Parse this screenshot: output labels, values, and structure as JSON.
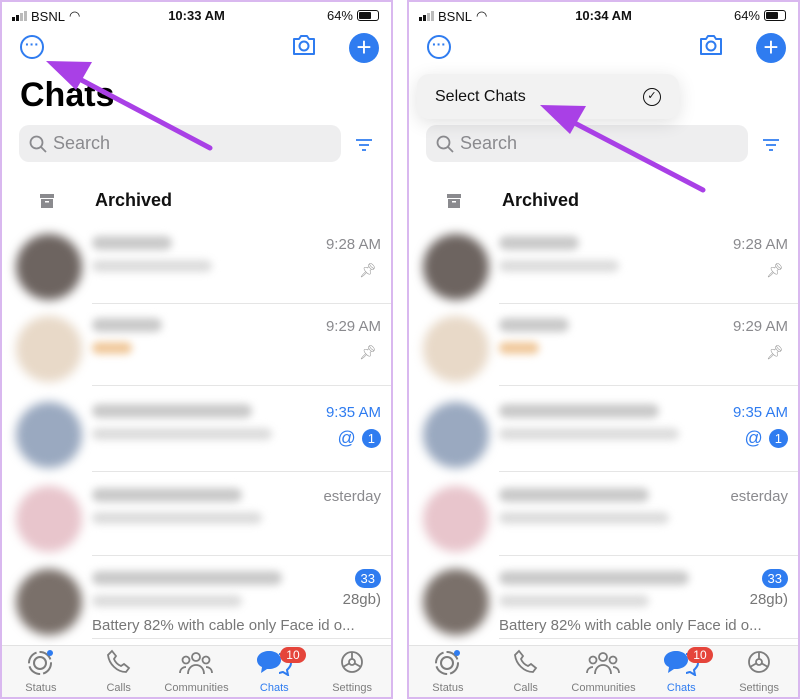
{
  "panels": [
    {
      "status": {
        "carrier": "BSNL",
        "time": "10:33 AM",
        "battery": "64%"
      },
      "menu": null
    },
    {
      "status": {
        "carrier": "BSNL",
        "time": "10:34 AM",
        "battery": "64%"
      },
      "menu": {
        "label": "Select Chats",
        "icon": "checkmark-circle-icon"
      }
    }
  ],
  "header": {
    "title": "Chats",
    "search_placeholder": "Search",
    "archived_label": "Archived"
  },
  "chats": [
    {
      "time": "9:28 AM",
      "pinned": true
    },
    {
      "time": "9:29 AM",
      "pinned": true
    },
    {
      "time": "9:35 AM",
      "unread_time": true,
      "mention": "@",
      "unread": "1"
    },
    {
      "time": "esterday"
    },
    {
      "unread": "33",
      "preview_end": "28gb)",
      "preview": "Battery 82% with cable only Face id o..."
    }
  ],
  "tabs": [
    {
      "label": "Status",
      "icon": "status-icon"
    },
    {
      "label": "Calls",
      "icon": "phone-icon"
    },
    {
      "label": "Communities",
      "icon": "communities-icon"
    },
    {
      "label": "Chats",
      "icon": "chat-bubbles-icon",
      "badge": "10",
      "active": true
    },
    {
      "label": "Settings",
      "icon": "gear-icon"
    }
  ],
  "colors": {
    "accent": "#2f7cf0",
    "badge_red": "#e5453b",
    "annotation_arrow": "#a940e6"
  }
}
